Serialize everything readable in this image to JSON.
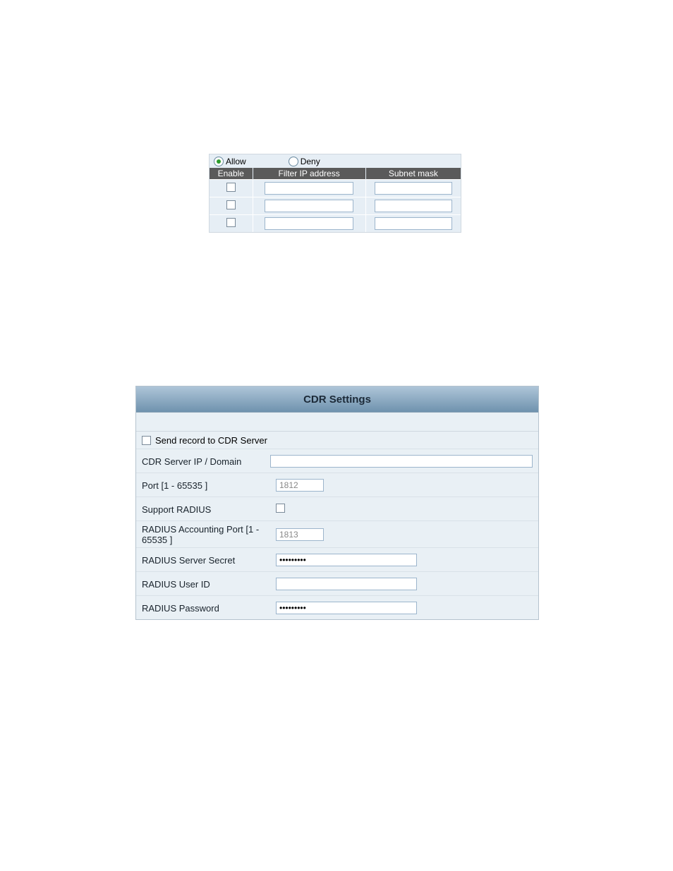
{
  "ipfilter": {
    "radio_allow": "Allow",
    "radio_deny": "Deny",
    "radio_selected": "allow",
    "col_enable": "Enable",
    "col_ip": "Filter IP address",
    "col_mask": "Subnet mask",
    "rows": [
      {
        "enable": false,
        "ip": "",
        "mask": ""
      },
      {
        "enable": false,
        "ip": "",
        "mask": ""
      },
      {
        "enable": false,
        "ip": "",
        "mask": ""
      }
    ]
  },
  "bullets_a": [
    "",
    ""
  ],
  "bullets_b": [
    "",
    "",
    "",
    "",
    "",
    ""
  ],
  "cdr": {
    "title": "CDR Settings",
    "send_label": "Send record to CDR Server",
    "send_checked": false,
    "fields": {
      "server_label": "CDR Server IP / Domain",
      "server_value": "",
      "port_label": "Port [1 - 65535 ]",
      "port_value": "1812",
      "support_radius_label": "Support RADIUS",
      "support_radius_checked": false,
      "acct_port_label": "RADIUS Accounting Port [1 - 65535 ]",
      "acct_port_value": "1813",
      "secret_label": "RADIUS Server Secret",
      "secret_value": "•••••••••",
      "user_label": "RADIUS User ID",
      "user_value": "",
      "password_label": "RADIUS Password",
      "password_value": "•••••••••"
    }
  }
}
